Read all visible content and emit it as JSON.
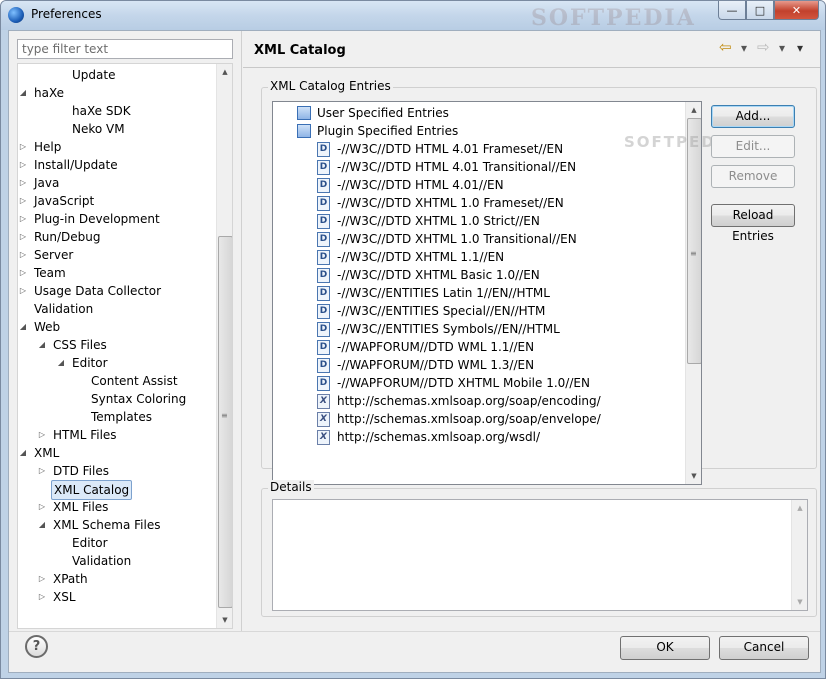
{
  "window": {
    "title": "Preferences",
    "watermark": "SOFTPEDIA"
  },
  "filter": {
    "placeholder": "type filter text"
  },
  "tree": [
    {
      "label": "Update",
      "level": 2,
      "twisty": ""
    },
    {
      "label": "haXe",
      "level": 0,
      "twisty": "open"
    },
    {
      "label": "haXe SDK",
      "level": 2,
      "twisty": ""
    },
    {
      "label": "Neko VM",
      "level": 2,
      "twisty": ""
    },
    {
      "label": "Help",
      "level": 0,
      "twisty": "closed"
    },
    {
      "label": "Install/Update",
      "level": 0,
      "twisty": "closed"
    },
    {
      "label": "Java",
      "level": 0,
      "twisty": "closed"
    },
    {
      "label": "JavaScript",
      "level": 0,
      "twisty": "closed"
    },
    {
      "label": "Plug-in Development",
      "level": 0,
      "twisty": "closed"
    },
    {
      "label": "Run/Debug",
      "level": 0,
      "twisty": "closed"
    },
    {
      "label": "Server",
      "level": 0,
      "twisty": "closed"
    },
    {
      "label": "Team",
      "level": 0,
      "twisty": "closed"
    },
    {
      "label": "Usage Data Collector",
      "level": 0,
      "twisty": "closed"
    },
    {
      "label": "Validation",
      "level": 0,
      "twisty": ""
    },
    {
      "label": "Web",
      "level": 0,
      "twisty": "open"
    },
    {
      "label": "CSS Files",
      "level": 1,
      "twisty": "open"
    },
    {
      "label": "Editor",
      "level": 2,
      "twisty": "open"
    },
    {
      "label": "Content Assist",
      "level": 3,
      "twisty": ""
    },
    {
      "label": "Syntax Coloring",
      "level": 3,
      "twisty": ""
    },
    {
      "label": "Templates",
      "level": 3,
      "twisty": ""
    },
    {
      "label": "HTML Files",
      "level": 1,
      "twisty": "closed"
    },
    {
      "label": "XML",
      "level": 0,
      "twisty": "open"
    },
    {
      "label": "DTD Files",
      "level": 1,
      "twisty": "closed"
    },
    {
      "label": "XML Catalog",
      "level": 1,
      "twisty": "",
      "selected": true
    },
    {
      "label": "XML Files",
      "level": 1,
      "twisty": "closed"
    },
    {
      "label": "XML Schema Files",
      "level": 1,
      "twisty": "open"
    },
    {
      "label": "Editor",
      "level": 2,
      "twisty": ""
    },
    {
      "label": "Validation",
      "level": 2,
      "twisty": ""
    },
    {
      "label": "XPath",
      "level": 1,
      "twisty": "closed"
    },
    {
      "label": "XSL",
      "level": 1,
      "twisty": "closed"
    }
  ],
  "page": {
    "title": "XML Catalog"
  },
  "entries_group": {
    "label": "XML Catalog Entries"
  },
  "entries": [
    {
      "text": "User Specified Entries",
      "kind": "cat",
      "level": 0
    },
    {
      "text": "Plugin Specified Entries",
      "kind": "cat",
      "level": 0
    },
    {
      "text": "-//W3C//DTD HTML 4.01 Frameset//EN",
      "kind": "D",
      "level": 1
    },
    {
      "text": "-//W3C//DTD HTML 4.01 Transitional//EN",
      "kind": "D",
      "level": 1
    },
    {
      "text": "-//W3C//DTD HTML 4.01//EN",
      "kind": "D",
      "level": 1
    },
    {
      "text": "-//W3C//DTD XHTML 1.0 Frameset//EN",
      "kind": "D",
      "level": 1
    },
    {
      "text": "-//W3C//DTD XHTML 1.0 Strict//EN",
      "kind": "D",
      "level": 1
    },
    {
      "text": "-//W3C//DTD XHTML 1.0 Transitional//EN",
      "kind": "D",
      "level": 1
    },
    {
      "text": "-//W3C//DTD XHTML 1.1//EN",
      "kind": "D",
      "level": 1
    },
    {
      "text": "-//W3C//DTD XHTML Basic 1.0//EN",
      "kind": "D",
      "level": 1
    },
    {
      "text": "-//W3C//ENTITIES Latin 1//EN//HTML",
      "kind": "D",
      "level": 1
    },
    {
      "text": "-//W3C//ENTITIES Special//EN//HTM",
      "kind": "D",
      "level": 1
    },
    {
      "text": "-//W3C//ENTITIES Symbols//EN//HTML",
      "kind": "D",
      "level": 1
    },
    {
      "text": "-//WAPFORUM//DTD WML 1.1//EN",
      "kind": "D",
      "level": 1
    },
    {
      "text": "-//WAPFORUM//DTD WML 1.3//EN",
      "kind": "D",
      "level": 1
    },
    {
      "text": "-//WAPFORUM//DTD XHTML Mobile 1.0//EN",
      "kind": "D",
      "level": 1
    },
    {
      "text": "http://schemas.xmlsoap.org/soap/encoding/",
      "kind": "X",
      "level": 1
    },
    {
      "text": "http://schemas.xmlsoap.org/soap/envelope/",
      "kind": "X",
      "level": 1
    },
    {
      "text": "http://schemas.xmlsoap.org/wsdl/",
      "kind": "X",
      "level": 1
    }
  ],
  "buttons": {
    "add": "Add...",
    "edit": "Edit...",
    "remove": "Remove",
    "reload": "Reload Entries",
    "ok": "OK",
    "cancel": "Cancel"
  },
  "details_group": {
    "label": "Details"
  },
  "icons": {
    "help": "?",
    "back": "⇦",
    "forward": "⇨",
    "dropdown": "▾",
    "minimize": "—",
    "maximize": "□",
    "close": "✕"
  }
}
